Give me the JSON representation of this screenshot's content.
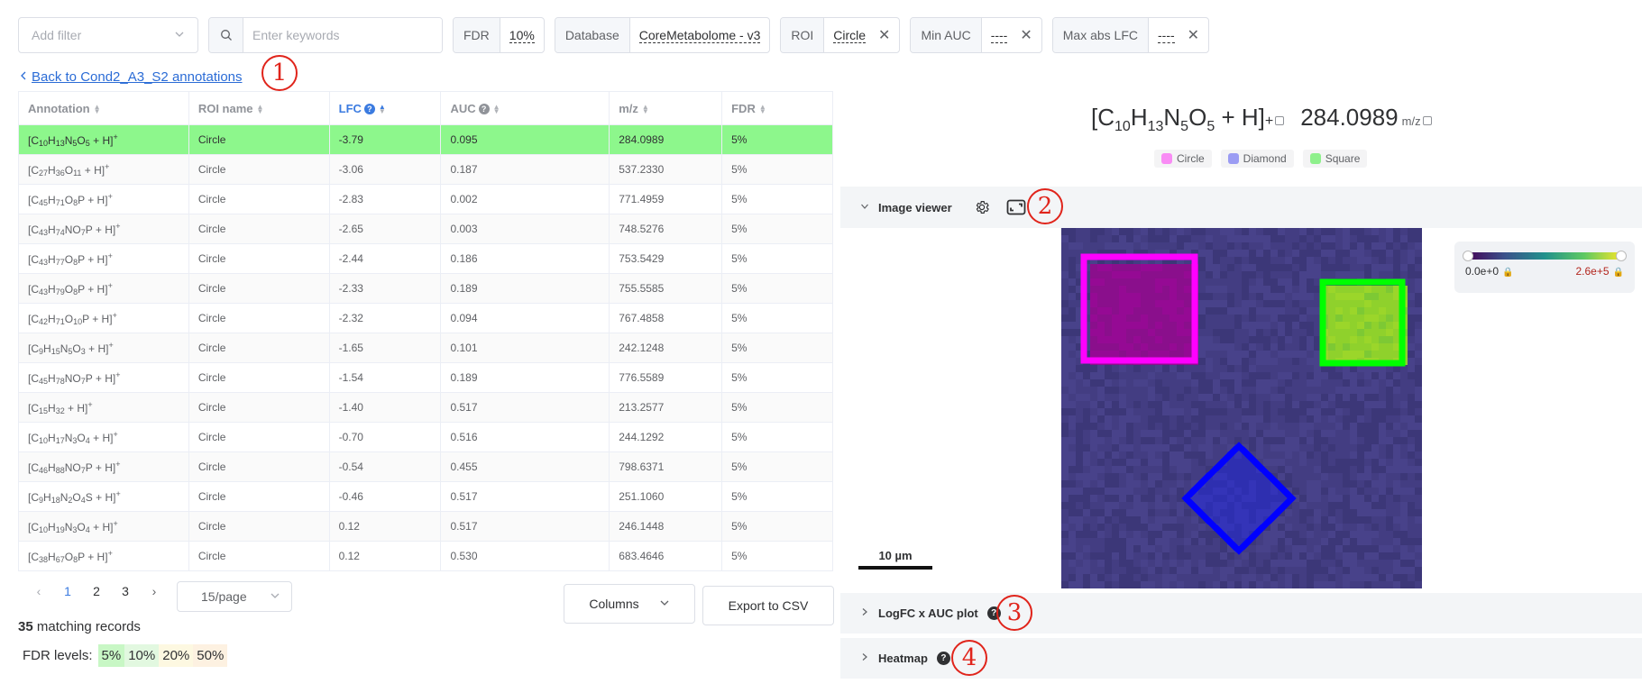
{
  "filters": {
    "add_filter_placeholder": "Add filter",
    "keywords_placeholder": "Enter keywords",
    "fdr": {
      "label": "FDR",
      "value": "10%"
    },
    "database": {
      "label": "Database",
      "value": "CoreMetabolome - v3"
    },
    "roi": {
      "label": "ROI",
      "value": "Circle"
    },
    "min_auc": {
      "label": "Min AUC",
      "value": "----"
    },
    "max_abs_lfc": {
      "label": "Max abs LFC",
      "value": "----"
    }
  },
  "back_link": "Back to Cond2_A3_S2 annotations",
  "markers": [
    "1",
    "2",
    "3",
    "4"
  ],
  "table": {
    "headers": {
      "annotation": "Annotation",
      "roi_name": "ROI name",
      "lfc": "LFC",
      "auc": "AUC",
      "mz": "m/z",
      "fdr": "FDR"
    },
    "rows": [
      {
        "formula": [
          [
            "C",
            "10"
          ],
          [
            "H",
            "13"
          ],
          [
            "N",
            "5"
          ],
          [
            "O",
            "5"
          ]
        ],
        "roi": "Circle",
        "lfc": "-3.79",
        "auc": "0.095",
        "mz": "284.0989",
        "fdr": "5%",
        "selected": true
      },
      {
        "formula": [
          [
            "C",
            "27"
          ],
          [
            "H",
            "36"
          ],
          [
            "O",
            "11"
          ]
        ],
        "roi": "Circle",
        "lfc": "-3.06",
        "auc": "0.187",
        "mz": "537.2330",
        "fdr": "5%"
      },
      {
        "formula": [
          [
            "C",
            "45"
          ],
          [
            "H",
            "71"
          ],
          [
            "O",
            "8"
          ],
          [
            "P",
            ""
          ]
        ],
        "roi": "Circle",
        "lfc": "-2.83",
        "auc": "0.002",
        "mz": "771.4959",
        "fdr": "5%"
      },
      {
        "formula": [
          [
            "C",
            "43"
          ],
          [
            "H",
            "74"
          ],
          [
            "NO",
            "7"
          ],
          [
            "P",
            ""
          ]
        ],
        "roi": "Circle",
        "lfc": "-2.65",
        "auc": "0.003",
        "mz": "748.5276",
        "fdr": "5%"
      },
      {
        "formula": [
          [
            "C",
            "43"
          ],
          [
            "H",
            "77"
          ],
          [
            "O",
            "8"
          ],
          [
            "P",
            ""
          ]
        ],
        "roi": "Circle",
        "lfc": "-2.44",
        "auc": "0.186",
        "mz": "753.5429",
        "fdr": "5%"
      },
      {
        "formula": [
          [
            "C",
            "43"
          ],
          [
            "H",
            "79"
          ],
          [
            "O",
            "8"
          ],
          [
            "P",
            ""
          ]
        ],
        "roi": "Circle",
        "lfc": "-2.33",
        "auc": "0.189",
        "mz": "755.5585",
        "fdr": "5%"
      },
      {
        "formula": [
          [
            "C",
            "42"
          ],
          [
            "H",
            "71"
          ],
          [
            "O",
            "10"
          ],
          [
            "P",
            ""
          ]
        ],
        "roi": "Circle",
        "lfc": "-2.32",
        "auc": "0.094",
        "mz": "767.4858",
        "fdr": "5%"
      },
      {
        "formula": [
          [
            "C",
            "9"
          ],
          [
            "H",
            "15"
          ],
          [
            "N",
            "5"
          ],
          [
            "O",
            "3"
          ]
        ],
        "roi": "Circle",
        "lfc": "-1.65",
        "auc": "0.101",
        "mz": "242.1248",
        "fdr": "5%"
      },
      {
        "formula": [
          [
            "C",
            "45"
          ],
          [
            "H",
            "78"
          ],
          [
            "NO",
            "7"
          ],
          [
            "P",
            ""
          ]
        ],
        "roi": "Circle",
        "lfc": "-1.54",
        "auc": "0.189",
        "mz": "776.5589",
        "fdr": "5%"
      },
      {
        "formula": [
          [
            "C",
            "15"
          ],
          [
            "H",
            "32"
          ]
        ],
        "roi": "Circle",
        "lfc": "-1.40",
        "auc": "0.517",
        "mz": "213.2577",
        "fdr": "5%"
      },
      {
        "formula": [
          [
            "C",
            "10"
          ],
          [
            "H",
            "17"
          ],
          [
            "N",
            "3"
          ],
          [
            "O",
            "4"
          ]
        ],
        "roi": "Circle",
        "lfc": "-0.70",
        "auc": "0.516",
        "mz": "244.1292",
        "fdr": "5%"
      },
      {
        "formula": [
          [
            "C",
            "46"
          ],
          [
            "H",
            "88"
          ],
          [
            "NO",
            "7"
          ],
          [
            "P",
            ""
          ]
        ],
        "roi": "Circle",
        "lfc": "-0.54",
        "auc": "0.455",
        "mz": "798.6371",
        "fdr": "5%"
      },
      {
        "formula": [
          [
            "C",
            "9"
          ],
          [
            "H",
            "18"
          ],
          [
            "N",
            "2"
          ],
          [
            "O",
            "4"
          ],
          [
            "S",
            ""
          ]
        ],
        "roi": "Circle",
        "lfc": "-0.46",
        "auc": "0.517",
        "mz": "251.1060",
        "fdr": "5%"
      },
      {
        "formula": [
          [
            "C",
            "10"
          ],
          [
            "H",
            "19"
          ],
          [
            "N",
            "3"
          ],
          [
            "O",
            "4"
          ]
        ],
        "roi": "Circle",
        "lfc": "0.12",
        "auc": "0.517",
        "mz": "246.1448",
        "fdr": "5%"
      },
      {
        "formula": [
          [
            "C",
            "38"
          ],
          [
            "H",
            "67"
          ],
          [
            "O",
            "8"
          ],
          [
            "P",
            ""
          ]
        ],
        "roi": "Circle",
        "lfc": "0.12",
        "auc": "0.530",
        "mz": "683.4646",
        "fdr": "5%"
      }
    ]
  },
  "pagination": {
    "pages": [
      "1",
      "2",
      "3"
    ],
    "current": "1",
    "per_page": "15/page"
  },
  "buttons": {
    "columns": "Columns",
    "export": "Export to CSV"
  },
  "matching": {
    "count": "35",
    "text": "matching records"
  },
  "fdr_levels": {
    "label": "FDR levels:",
    "levels": [
      {
        "text": "5%",
        "color": "#c8f7c5"
      },
      {
        "text": "10%",
        "color": "#e2f8e0"
      },
      {
        "text": "20%",
        "color": "#fdf8e1"
      },
      {
        "text": "50%",
        "color": "#fdf1e1"
      }
    ]
  },
  "detail": {
    "formula": [
      [
        "C",
        "10"
      ],
      [
        "H",
        "13"
      ],
      [
        "N",
        "5"
      ],
      [
        "O",
        "5"
      ]
    ],
    "adduct_open": "[",
    "adduct_close": " + H]",
    "charge": "+",
    "mz": "284.0989",
    "mz_unit": "m/z"
  },
  "roi_legend": [
    {
      "name": "Circle",
      "color": "#f98cf5"
    },
    {
      "name": "Diamond",
      "color": "#9b9cf3"
    },
    {
      "name": "Square",
      "color": "#8ef08c"
    }
  ],
  "sections": {
    "image_viewer": "Image viewer",
    "logfc_auc": "LogFC x AUC plot",
    "heatmap": "Heatmap"
  },
  "image": {
    "scale_label": "10 µm",
    "colorbar_min": "0.0e+0",
    "colorbar_max": "2.6e+5",
    "roi_colors": {
      "circle": "#ff00ff",
      "square": "#00ff00",
      "diamond": "#0000ff"
    }
  }
}
